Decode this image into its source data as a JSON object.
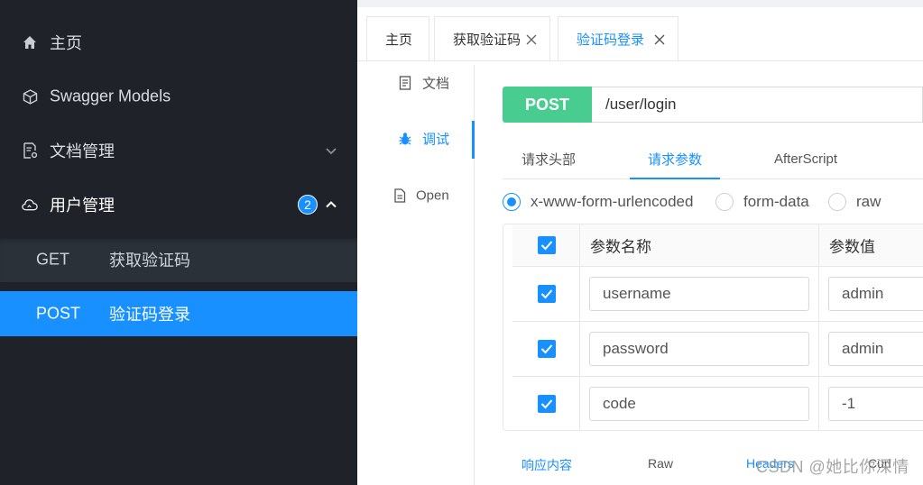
{
  "sidebar": {
    "items": [
      {
        "label": "主页",
        "icon": "home-icon"
      },
      {
        "label": "Swagger Models",
        "icon": "cube-icon"
      },
      {
        "label": "文档管理",
        "icon": "doc-settings-icon"
      },
      {
        "label": "用户管理",
        "icon": "cloud-icon",
        "badge": "2"
      }
    ],
    "sub_items": [
      {
        "method": "GET",
        "label": "获取验证码"
      },
      {
        "method": "POST",
        "label": "验证码登录"
      }
    ]
  },
  "tabs": [
    {
      "label": "主页"
    },
    {
      "label": "获取验证码"
    },
    {
      "label": "验证码登录"
    }
  ],
  "side_tabs": [
    {
      "label": "文档"
    },
    {
      "label": "调试"
    },
    {
      "label": "Open"
    }
  ],
  "request": {
    "method": "POST",
    "url": "/user/login",
    "method_color": "#49cc90"
  },
  "sub_tabs": [
    "请求头部",
    "请求参数",
    "AfterScript"
  ],
  "body_types": [
    "x-www-form-urlencoded",
    "form-data",
    "raw"
  ],
  "params": {
    "headers": [
      "参数名称",
      "参数值"
    ],
    "rows": [
      {
        "name": "username",
        "value": "admin"
      },
      {
        "name": "password",
        "value": "admin"
      },
      {
        "name": "code",
        "value": "-1"
      }
    ]
  },
  "response_tabs": [
    "响应内容",
    "Raw",
    "Headers",
    "Curl"
  ],
  "watermark": "CSDN @她比你深情",
  "accent_color": "#1890ff"
}
